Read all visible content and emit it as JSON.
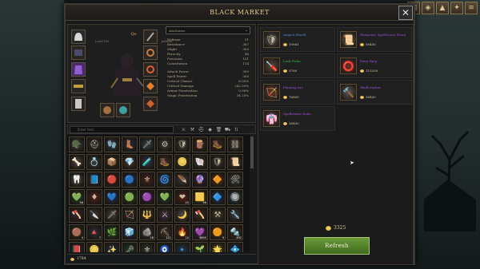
{
  "window": {
    "title": "Black Market"
  },
  "top_tools": [
    "book-icon",
    "bag-icon",
    "chevron-icon",
    "skills-icon",
    "menu-icon"
  ],
  "character": {
    "name": "Qo",
    "level_label": "Level 100",
    "class_label": "paladin",
    "stats_dropdown": "Attributes",
    "stats_group1": [
      {
        "label": "Defense",
        "value": "51"
      },
      {
        "label": "Resistance",
        "value": "367"
      },
      {
        "label": "Might",
        "value": "300"
      },
      {
        "label": "Ferocity",
        "value": "46"
      },
      {
        "label": "Precision",
        "value": "131"
      },
      {
        "label": "Constitution",
        "value": "154"
      }
    ],
    "stats_group2": [
      {
        "label": "Attack Power",
        "value": "300"
      },
      {
        "label": "Spell Power",
        "value": "300"
      },
      {
        "label": "Critical Chance",
        "value": "6.00%"
      },
      {
        "label": "Critical Damage",
        "value": "242.00%"
      },
      {
        "label": "Armor Penetration",
        "value": "0.00%"
      },
      {
        "label": "Magic Penetration",
        "value": "34.25%"
      }
    ]
  },
  "search": {
    "placeholder": "Enter text..."
  },
  "inventory": {
    "items": [
      {
        "icon": "🪖",
        "color": "#8aa0b0"
      },
      {
        "icon": "⛑",
        "color": "#7a7a7a"
      },
      {
        "icon": "🧤",
        "color": "#6a8aa0"
      },
      {
        "icon": "👢",
        "color": "#3a6a9a"
      },
      {
        "icon": "🗡",
        "color": "#6aa0c0"
      },
      {
        "icon": "⚙",
        "color": "#8a8a8a"
      },
      {
        "icon": "🛡",
        "color": "#7a8a7a"
      },
      {
        "icon": "🪵",
        "color": "#8a5a3a"
      },
      {
        "icon": "🥾",
        "color": "#8a5a3a"
      },
      {
        "icon": "⛓",
        "color": "#9a9a9a"
      },
      {
        "icon": "🦴",
        "color": "#c0b090"
      },
      {
        "icon": "💍",
        "color": "#6a9aa0"
      },
      {
        "icon": "📦",
        "color": "#8a6a3a"
      },
      {
        "icon": "💎",
        "color": "#e08030"
      },
      {
        "icon": "🧪",
        "color": "#6a8ac0"
      },
      {
        "icon": "🥾",
        "color": "#8a6a4a"
      },
      {
        "icon": "🪙",
        "color": "#c0a040"
      },
      {
        "icon": "🐚",
        "color": "#9a8a6a"
      },
      {
        "icon": "🛡",
        "color": "#7a7a7a"
      },
      {
        "icon": "📜",
        "color": "#c0b080"
      },
      {
        "icon": "🦷",
        "color": "#d0c0a0"
      },
      {
        "icon": "📘",
        "color": "#3a6ab0"
      },
      {
        "icon": "🔴",
        "color": "#c03030"
      },
      {
        "icon": "🔵",
        "color": "#3a7ad0"
      },
      {
        "icon": "⚜",
        "color": "#b04040"
      },
      {
        "icon": "🌀",
        "color": "#6a9ab0"
      },
      {
        "icon": "🪶",
        "color": "#8a8aa0"
      },
      {
        "icon": "🔮",
        "color": "#6a4ab0"
      },
      {
        "icon": "🔶",
        "color": "#e08020"
      },
      {
        "icon": "🛠",
        "color": "#7a9ab0"
      },
      {
        "icon": "💚",
        "color": "#30b040",
        "qty": "56"
      },
      {
        "icon": "♦",
        "color": "#e04040"
      },
      {
        "icon": "💙",
        "color": "#3060e0"
      },
      {
        "icon": "🟢",
        "color": "#40c040"
      },
      {
        "icon": "🟣",
        "color": "#9040e0"
      },
      {
        "icon": "💚",
        "color": "#20a040"
      },
      {
        "icon": "❤",
        "color": "#e03030",
        "qty": "25"
      },
      {
        "icon": "🟨",
        "color": "#e0c020",
        "qty": "56"
      },
      {
        "icon": "🔷",
        "color": "#3080e0"
      },
      {
        "icon": "🔘",
        "color": "#30b0c0"
      },
      {
        "icon": "🪓",
        "color": "#8a4a8a"
      },
      {
        "icon": "🔪",
        "color": "#8a8a8a"
      },
      {
        "icon": "🗡",
        "color": "#9a9a9a"
      },
      {
        "icon": "🏹",
        "color": "#6a6a6a"
      },
      {
        "icon": "🔱",
        "color": "#a08060"
      },
      {
        "icon": "⚔",
        "color": "#9a6aa0"
      },
      {
        "icon": "🌙",
        "color": "#c0c0c0"
      },
      {
        "icon": "🪓",
        "color": "#8a6a4a"
      },
      {
        "icon": "⚒",
        "color": "#9a8a6a"
      },
      {
        "icon": "🔧",
        "color": "#8a8a9a"
      },
      {
        "icon": "🟤",
        "color": "#8a6a3a",
        "qty": "4"
      },
      {
        "icon": "🔺",
        "color": "#6a6a8a",
        "qty": "7"
      },
      {
        "icon": "🌿",
        "color": "#40a060"
      },
      {
        "icon": "🧊",
        "color": "#4080e0"
      },
      {
        "icon": "🪨",
        "color": "#8a8aa0",
        "qty": "18"
      },
      {
        "icon": "⛏",
        "color": "#8a6a4a",
        "qty": "121"
      },
      {
        "icon": "🔥",
        "color": "#e04020",
        "qty": "10"
      },
      {
        "icon": "💜",
        "color": "#a040e0",
        "qty": "9805"
      },
      {
        "icon": "🟠",
        "color": "#e08020",
        "qty": "9"
      },
      {
        "icon": "🔩",
        "color": "#8a6a4a",
        "qty": "492"
      },
      {
        "icon": "📕",
        "color": "#2a6a9a"
      },
      {
        "icon": "🪙",
        "color": "#c0a040"
      },
      {
        "icon": "✨",
        "color": "#3060e0"
      },
      {
        "icon": "🗝",
        "color": "#2a8a5a"
      },
      {
        "icon": "⚜",
        "color": "#6a8a6a"
      },
      {
        "icon": "🧿",
        "color": "#3a6a6a"
      },
      {
        "icon": "🔹",
        "color": "#4080c0"
      },
      {
        "icon": "🌱",
        "color": "#40a040"
      },
      {
        "icon": "🌟",
        "color": "#d0c040"
      },
      {
        "icon": "💠",
        "color": "#6040c0"
      }
    ]
  },
  "player_gold": "1784",
  "market": {
    "offers": [
      {
        "name": "August Shield",
        "price": "10861",
        "icon": "🛡",
        "name_color": "#5a8ae0",
        "icon_color": "#9aa6b0"
      },
      {
        "name": "Blueprint: Spellweave Hood",
        "price": "58400",
        "icon": "📜",
        "name_color": "#a050e0",
        "icon_color": "#e0c080"
      },
      {
        "name": "Lock Picks",
        "price": "5760",
        "icon": "🪛",
        "name_color": "#40c050",
        "icon_color": "#c08060"
      },
      {
        "name": "Fiery Ring",
        "price": "115200",
        "icon": "⭕",
        "name_color": "#a050e0",
        "icon_color": "#e04020"
      },
      {
        "name": "Flaming Arc",
        "price": "76800",
        "icon": "🏹",
        "name_color": "#a050e0",
        "icon_color": "#e06020"
      },
      {
        "name": "Skullcrusher",
        "price": "38400",
        "icon": "🔨",
        "name_color": "#a050e0",
        "icon_color": "#b0b0b0"
      },
      {
        "name": "Spellweave Robe",
        "price": "38400",
        "icon": "👘",
        "name_color": "#a050e0",
        "icon_color": "#e060a0"
      }
    ],
    "gold": "3325",
    "refresh_label": "Refresh"
  }
}
